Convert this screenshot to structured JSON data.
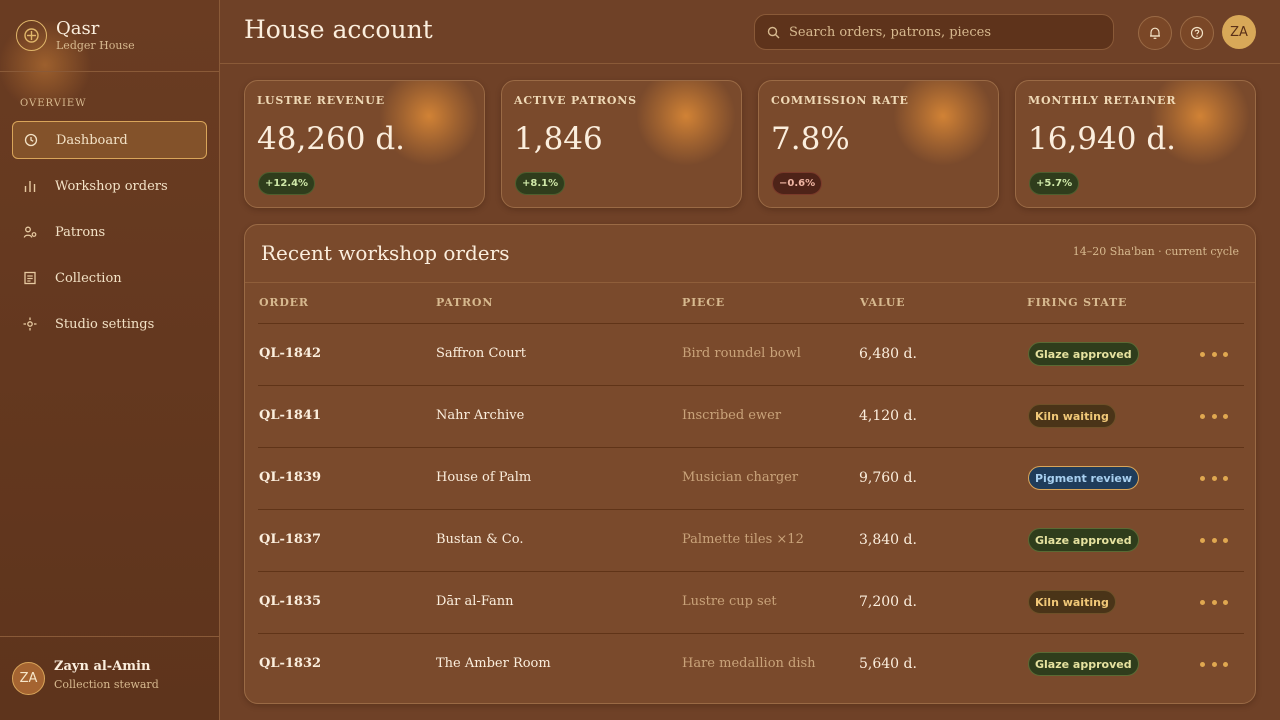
{
  "brand": {
    "name": "Qasr",
    "subtitle": "Ledger House"
  },
  "sidebar": {
    "section_label": "OVERVIEW",
    "items": [
      {
        "label": "Dashboard",
        "icon": "clock-icon",
        "active": true
      },
      {
        "label": "Workshop orders",
        "icon": "bar-chart-icon"
      },
      {
        "label": "Patrons",
        "icon": "users-icon"
      },
      {
        "label": "Collection",
        "icon": "document-icon"
      },
      {
        "label": "Studio settings",
        "icon": "settings-icon"
      }
    ],
    "user": {
      "initials": "ZA",
      "name": "Zayn al-Amin",
      "role": "Collection steward"
    }
  },
  "header": {
    "title": "House account",
    "search_placeholder": "Search orders, patrons, pieces",
    "avatar_initials": "ZA"
  },
  "kpis": [
    {
      "label": "LUSTRE REVENUE",
      "value": "48,260 d.",
      "delta": "+12.4%",
      "trend": "up"
    },
    {
      "label": "ACTIVE PATRONS",
      "value": "1,846",
      "delta": "+8.1%",
      "trend": "up"
    },
    {
      "label": "COMMISSION RATE",
      "value": "7.8%",
      "delta": "−0.6%",
      "trend": "down"
    },
    {
      "label": "MONTHLY RETAINER",
      "value": "16,940 d.",
      "delta": "+5.7%",
      "trend": "up"
    }
  ],
  "orders": {
    "title": "Recent workshop orders",
    "meta": "14–20 Sha'ban · current cycle",
    "columns": [
      "ORDER",
      "PATRON",
      "PIECE",
      "VALUE",
      "FIRING STATE"
    ],
    "rows": [
      {
        "order": "QL-1842",
        "patron": "Saffron Court",
        "piece": "Bird roundel bowl",
        "value": "6,480 d.",
        "state": "Glaze approved"
      },
      {
        "order": "QL-1841",
        "patron": "Nahr Archive",
        "piece": "Inscribed ewer",
        "value": "4,120 d.",
        "state": "Kiln waiting"
      },
      {
        "order": "QL-1839",
        "patron": "House of Palm",
        "piece": "Musician charger",
        "value": "9,760 d.",
        "state": "Pigment review"
      },
      {
        "order": "QL-1837",
        "patron": "Bustan & Co.",
        "piece": "Palmette tiles ×12",
        "value": "3,840 d.",
        "state": "Glaze approved"
      },
      {
        "order": "QL-1835",
        "patron": "Dār al-Fann",
        "piece": "Lustre cup set",
        "value": "7,200 d.",
        "state": "Kiln waiting"
      },
      {
        "order": "QL-1832",
        "patron": "The Amber Room",
        "piece": "Hare medallion dish",
        "value": "5,640 d.",
        "state": "Glaze approved"
      }
    ]
  },
  "colors": {
    "accent": "#d9a55a",
    "background": "#6f4127",
    "card": "#7a4a2c",
    "positive": "#2f3d1c",
    "negative": "#4e2318"
  }
}
